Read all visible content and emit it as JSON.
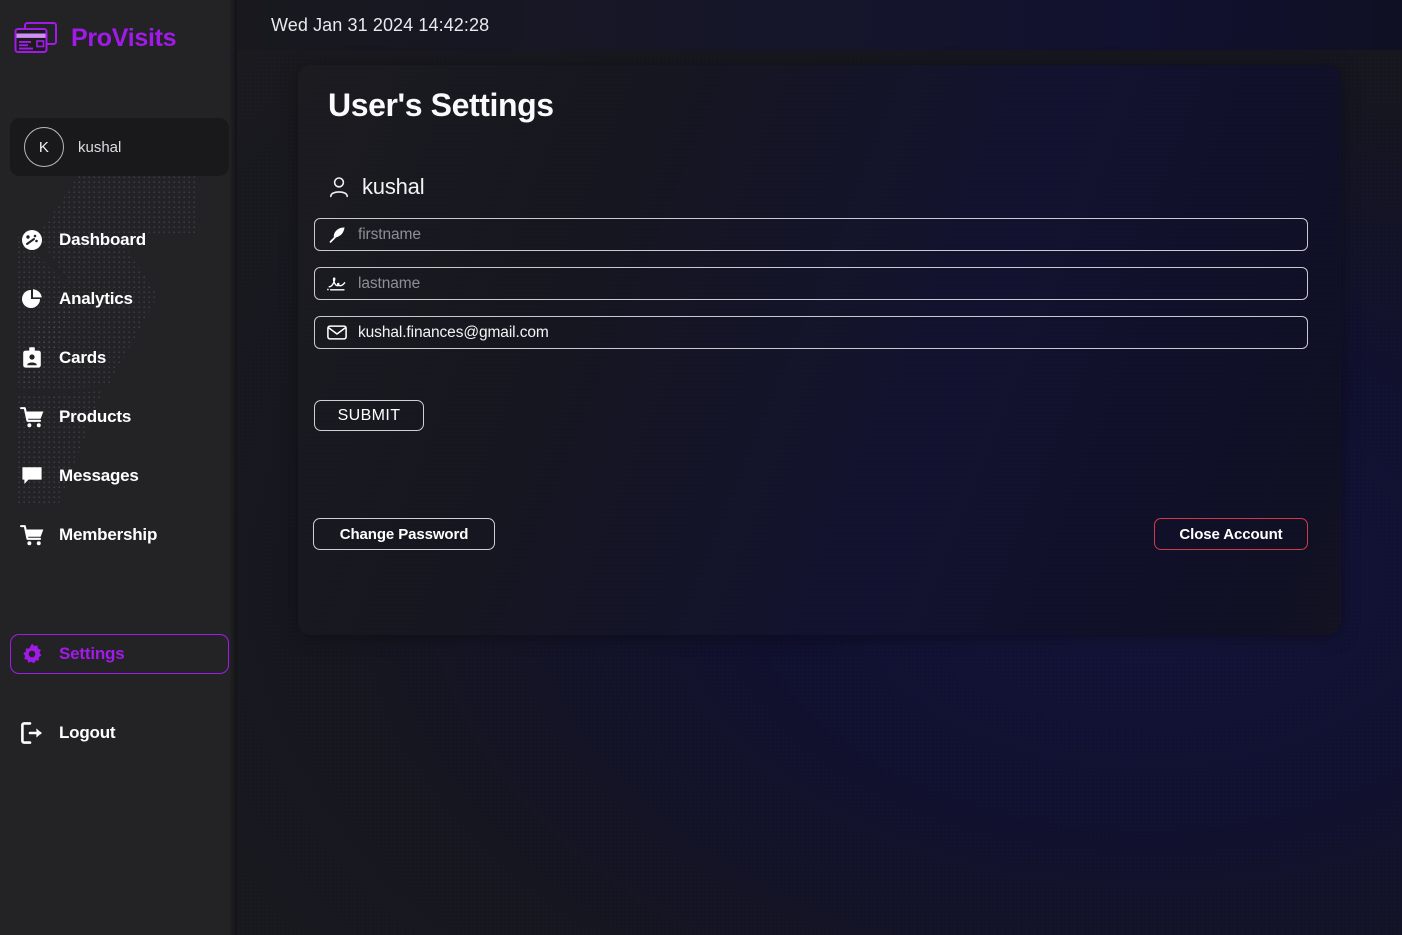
{
  "brand": {
    "name": "ProVisits",
    "icon": "credit-cards-icon",
    "color": "#a21ae8"
  },
  "sidebar": {
    "user": {
      "avatar_initial": "K",
      "name": "kushal"
    },
    "items": [
      {
        "label": "Dashboard",
        "icon": "dashboard-gauge-icon",
        "active": false
      },
      {
        "label": "Analytics",
        "icon": "pie-chart-icon",
        "active": false
      },
      {
        "label": "Cards",
        "icon": "id-card-icon",
        "active": false
      },
      {
        "label": "Products",
        "icon": "shopping-cart-icon",
        "active": false
      },
      {
        "label": "Messages",
        "icon": "chat-bubble-icon",
        "active": false
      },
      {
        "label": "Membership",
        "icon": "shopping-cart-icon",
        "active": false
      },
      {
        "label": "Settings",
        "icon": "gear-icon",
        "active": true
      },
      {
        "label": "Logout",
        "icon": "logout-arrow-icon",
        "active": false
      }
    ],
    "active_color": "#a21ae8"
  },
  "topbar": {
    "datetime": "Wed Jan 31 2024 14:42:28"
  },
  "panel": {
    "title": "User's Settings",
    "account": {
      "icon": "person-icon",
      "name": "kushal"
    },
    "fields": [
      {
        "name": "firstname",
        "icon": "feather-pen-icon",
        "value": "",
        "placeholder": "firstname"
      },
      {
        "name": "lastname",
        "icon": "signature-icon",
        "value": "",
        "placeholder": "lastname"
      },
      {
        "name": "email",
        "icon": "envelope-icon",
        "value": "kushal.finances@gmail.com",
        "placeholder": "email"
      }
    ],
    "submit_label": "SUBMIT",
    "change_password_label": "Change Password",
    "close_account_label": "Close Account",
    "close_account_color": "#d1384a"
  }
}
